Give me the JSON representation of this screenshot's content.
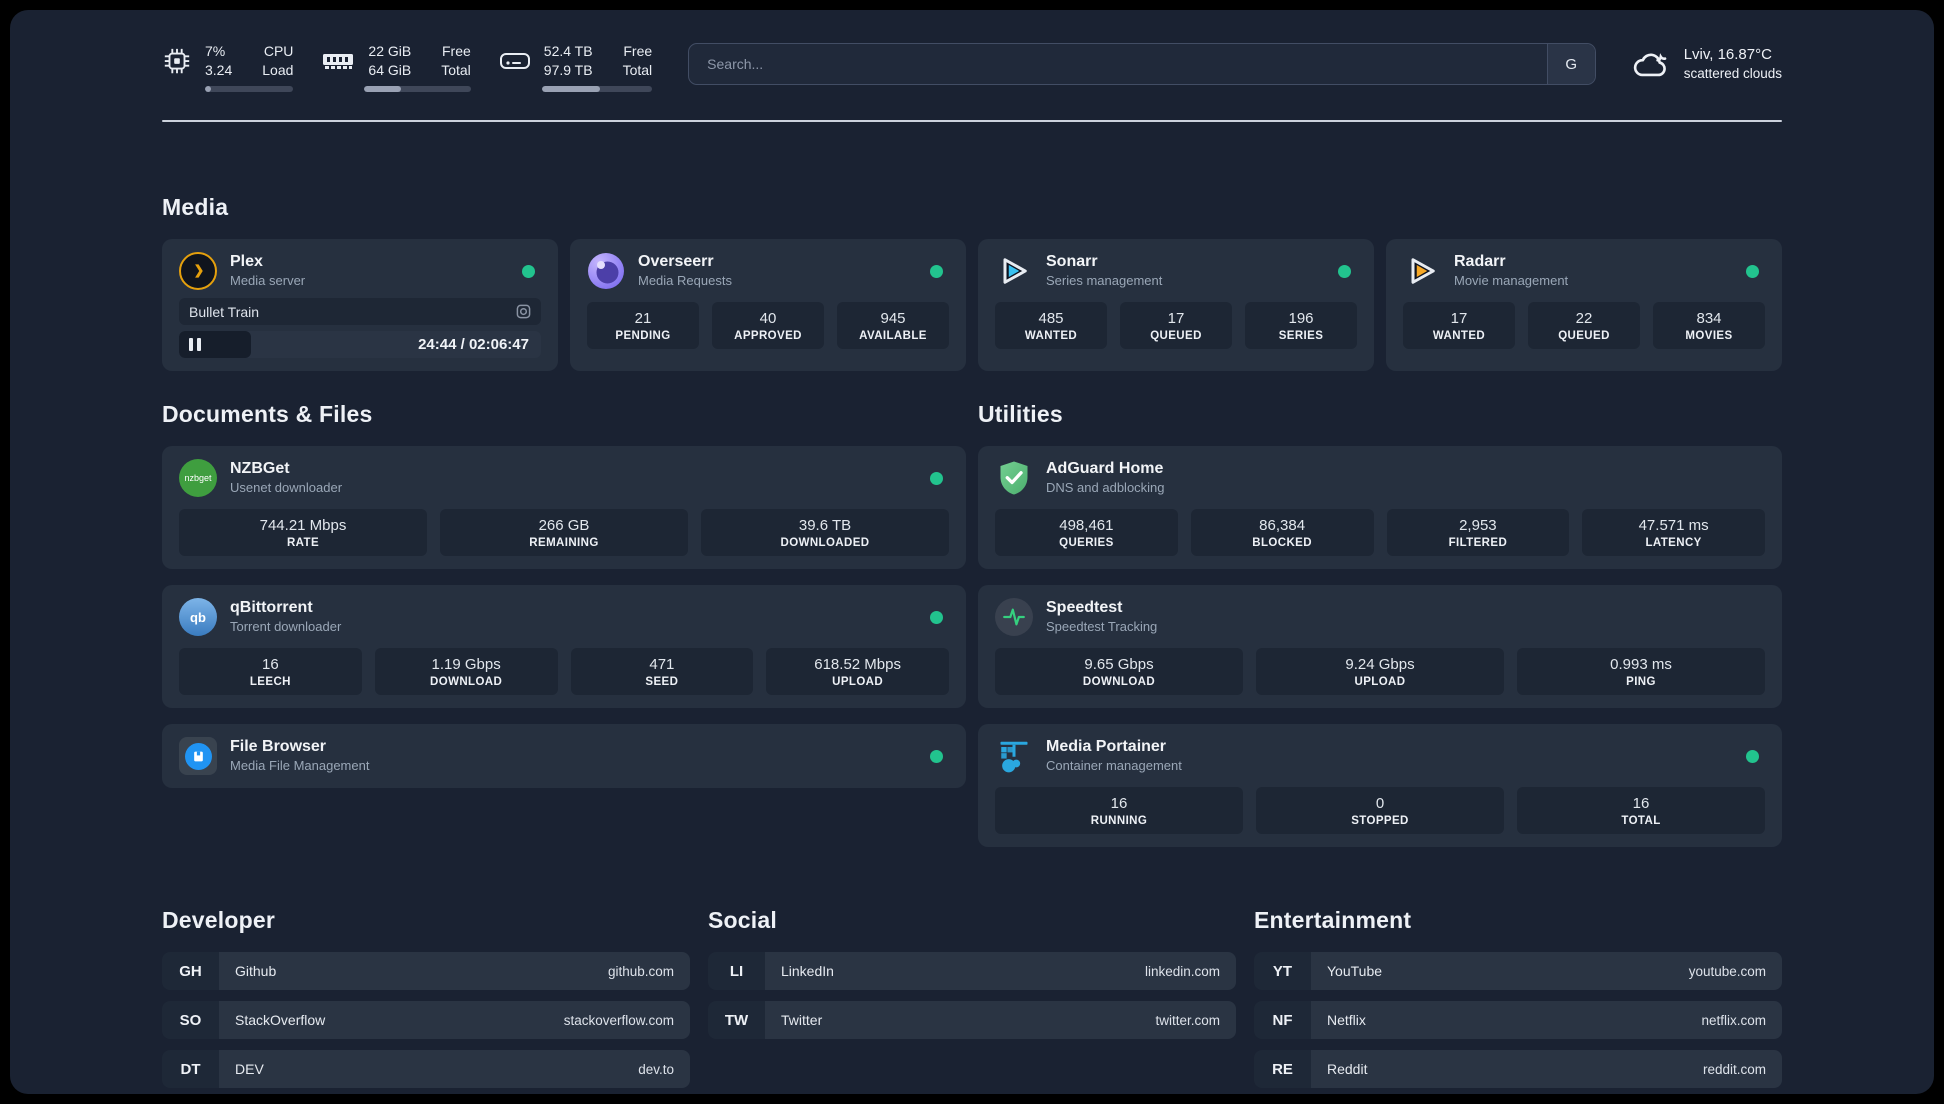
{
  "colors": {
    "status_online": "#22c38e",
    "page_bg": "#1a2232",
    "card_bg": "#26303f"
  },
  "topbar": {
    "cpu": {
      "values": [
        "7%",
        "3.24"
      ],
      "labels": [
        "CPU",
        "Load"
      ],
      "progress_pct": 7
    },
    "memory": {
      "values": [
        "22 GiB",
        "64 GiB"
      ],
      "labels": [
        "Free",
        "Total"
      ],
      "progress_pct": 34
    },
    "storage": {
      "values": [
        "52.4 TB",
        "97.9 TB"
      ],
      "labels": [
        "Free",
        "Total"
      ],
      "progress_pct": 53
    },
    "search": {
      "placeholder": "Search...",
      "engine_label": "G"
    },
    "weather": {
      "location": "Lviv, 16.87°C",
      "condition": "scattered clouds"
    }
  },
  "media": {
    "title": "Media",
    "plex": {
      "name": "Plex",
      "subtitle": "Media server",
      "status": "online",
      "player": {
        "media_title": "Bullet Train",
        "time": "24:44 / 02:06:47",
        "progress_pct": 20
      }
    },
    "overseerr": {
      "name": "Overseerr",
      "subtitle": "Media Requests",
      "status": "online",
      "stats": [
        {
          "value": "21",
          "label": "PENDING"
        },
        {
          "value": "40",
          "label": "APPROVED"
        },
        {
          "value": "945",
          "label": "AVAILABLE"
        }
      ]
    },
    "sonarr": {
      "name": "Sonarr",
      "subtitle": "Series management",
      "status": "online",
      "stats": [
        {
          "value": "485",
          "label": "WANTED"
        },
        {
          "value": "17",
          "label": "QUEUED"
        },
        {
          "value": "196",
          "label": "SERIES"
        }
      ]
    },
    "radarr": {
      "name": "Radarr",
      "subtitle": "Movie management",
      "status": "online",
      "stats": [
        {
          "value": "17",
          "label": "WANTED"
        },
        {
          "value": "22",
          "label": "QUEUED"
        },
        {
          "value": "834",
          "label": "MOVIES"
        }
      ]
    }
  },
  "documents": {
    "title": "Documents & Files",
    "nzbget": {
      "name": "NZBGet",
      "subtitle": "Usenet downloader",
      "status": "online",
      "stats": [
        {
          "value": "744.21 Mbps",
          "label": "RATE"
        },
        {
          "value": "266 GB",
          "label": "REMAINING"
        },
        {
          "value": "39.6 TB",
          "label": "DOWNLOADED"
        }
      ]
    },
    "qbittorrent": {
      "name": "qBittorrent",
      "subtitle": "Torrent downloader",
      "status": "online",
      "stats": [
        {
          "value": "16",
          "label": "LEECH"
        },
        {
          "value": "1.19 Gbps",
          "label": "DOWNLOAD"
        },
        {
          "value": "471",
          "label": "SEED"
        },
        {
          "value": "618.52 Mbps",
          "label": "UPLOAD"
        }
      ]
    },
    "filebrowser": {
      "name": "File Browser",
      "subtitle": "Media File Management",
      "status": "online"
    }
  },
  "utilities": {
    "title": "Utilities",
    "adguard": {
      "name": "AdGuard Home",
      "subtitle": "DNS and adblocking",
      "stats": [
        {
          "value": "498,461",
          "label": "QUERIES"
        },
        {
          "value": "86,384",
          "label": "BLOCKED"
        },
        {
          "value": "2,953",
          "label": "FILTERED"
        },
        {
          "value": "47.571 ms",
          "label": "LATENCY"
        }
      ]
    },
    "speedtest": {
      "name": "Speedtest",
      "subtitle": "Speedtest Tracking",
      "stats": [
        {
          "value": "9.65 Gbps",
          "label": "DOWNLOAD"
        },
        {
          "value": "9.24 Gbps",
          "label": "UPLOAD"
        },
        {
          "value": "0.993 ms",
          "label": "PING"
        }
      ]
    },
    "portainer": {
      "name": "Media Portainer",
      "subtitle": "Container management",
      "status": "online",
      "stats": [
        {
          "value": "16",
          "label": "RUNNING"
        },
        {
          "value": "0",
          "label": "STOPPED"
        },
        {
          "value": "16",
          "label": "TOTAL"
        }
      ]
    }
  },
  "bookmarks": {
    "developer": {
      "title": "Developer",
      "items": [
        {
          "abbr": "GH",
          "name": "Github",
          "url": "github.com"
        },
        {
          "abbr": "SO",
          "name": "StackOverflow",
          "url": "stackoverflow.com"
        },
        {
          "abbr": "DT",
          "name": "DEV",
          "url": "dev.to"
        }
      ]
    },
    "social": {
      "title": "Social",
      "items": [
        {
          "abbr": "LI",
          "name": "LinkedIn",
          "url": "linkedin.com"
        },
        {
          "abbr": "TW",
          "name": "Twitter",
          "url": "twitter.com"
        }
      ]
    },
    "entertainment": {
      "title": "Entertainment",
      "items": [
        {
          "abbr": "YT",
          "name": "YouTube",
          "url": "youtube.com"
        },
        {
          "abbr": "NF",
          "name": "Netflix",
          "url": "netflix.com"
        },
        {
          "abbr": "RE",
          "name": "Reddit",
          "url": "reddit.com"
        }
      ]
    }
  }
}
